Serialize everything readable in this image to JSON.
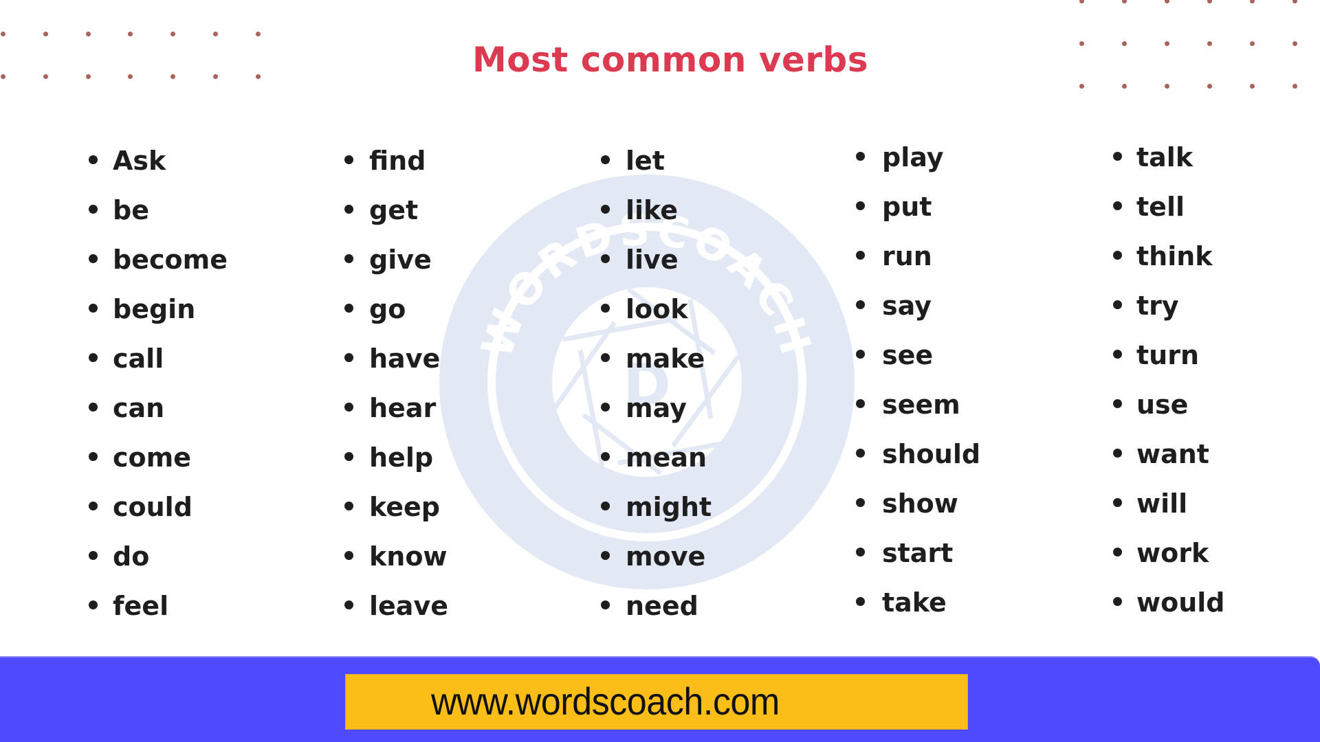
{
  "title": "Most common verbs",
  "colors": {
    "title": "#dc3a50",
    "text": "#1e1e1e",
    "dots": "#a8645c",
    "footer_band": "#4f4aff",
    "url_box": "#fbbd18",
    "watermark": "#e3e9f4"
  },
  "watermark": {
    "ring_text": "WORDSCOACH",
    "center_letter": "D"
  },
  "columns": [
    {
      "items": [
        "Ask",
        "be",
        "become",
        "begin",
        "call",
        "can",
        "come",
        "could",
        "do",
        "feel"
      ]
    },
    {
      "items": [
        "find",
        "get",
        "give",
        "go",
        "have",
        "hear",
        "help",
        "keep",
        "know",
        "leave"
      ]
    },
    {
      "items": [
        "let",
        "like",
        "live",
        "look",
        "make",
        "may",
        "mean",
        "might",
        "move",
        "need"
      ]
    },
    {
      "items": [
        "play",
        "put",
        "run",
        "say",
        "see",
        "seem",
        "should",
        "show",
        "start",
        "take"
      ]
    },
    {
      "items": [
        "talk",
        "tell",
        "think",
        "try",
        "turn",
        "use",
        "want",
        "will",
        "work",
        "would"
      ]
    }
  ],
  "footer": {
    "url": "www.wordscoach.com"
  }
}
